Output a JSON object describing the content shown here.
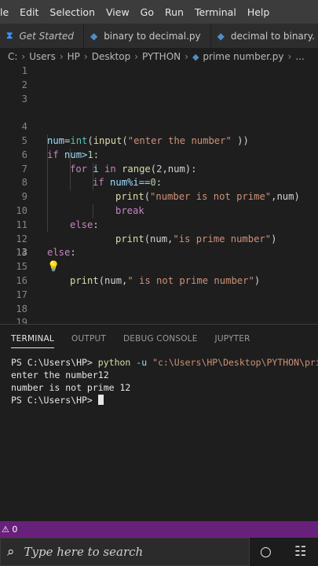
{
  "menubar": {
    "items": [
      "le",
      "Edit",
      "Selection",
      "View",
      "Go",
      "Run",
      "Terminal",
      "Help"
    ]
  },
  "tabs": [
    {
      "label": "Get Started",
      "icon": "vscode-icon",
      "active": true
    },
    {
      "label": "binary to decimal.py",
      "icon": "python-file-icon",
      "active": false
    },
    {
      "label": "decimal to binary.",
      "icon": "python-file-icon",
      "active": false
    }
  ],
  "breadcrumb": {
    "items": [
      "C:",
      "Users",
      "HP",
      "Desktop",
      "PYTHON",
      "prime number.py",
      "..."
    ]
  },
  "editor": {
    "line_numbers": [
      "1",
      "2",
      "3",
      "4",
      "5",
      "6",
      "7",
      "8",
      "9",
      "10",
      "11",
      "12",
      "13",
      "14",
      "15",
      "16",
      "17",
      "18",
      "19"
    ],
    "current_line": "13",
    "code": {
      "l4_a": "num",
      "l4_b": "=",
      "l4_c": "int",
      "l4_d": "(",
      "l4_e": "input",
      "l4_f": "(",
      "l4_g": "\"enter the number\"",
      "l4_h": " ))",
      "l5_a": "if",
      "l5_b": " num>",
      "l5_c": "1",
      "l5_d": ":",
      "l6_a": "for",
      "l6_b": " i ",
      "l6_c": "in",
      "l6_d": " ",
      "l6_e": "range",
      "l6_f": "(",
      "l6_g": "2",
      "l6_h": ",num):",
      "l7_a": "if",
      "l7_b": " num%i==",
      "l7_c": "0",
      "l7_d": ":",
      "l8_a": "print",
      "l8_b": "(",
      "l8_c": "\"number is not prime\"",
      "l8_d": ",num)",
      "l9_a": "break",
      "l10_a": "else",
      "l10_b": ":",
      "l11_a": "print",
      "l11_b": "(num,",
      "l11_c": "\"is prime number\"",
      "l11_d": ")",
      "l12_a": "else",
      "l12_b": ":",
      "l13_a": "print",
      "l13_b": "(num,",
      "l13_c": "\" is not prime number\"",
      "l13_d": ")"
    }
  },
  "panel": {
    "tabs": [
      {
        "label": "TERMINAL",
        "active": true
      },
      {
        "label": "OUTPUT",
        "active": false
      },
      {
        "label": "DEBUG CONSOLE",
        "active": false
      },
      {
        "label": "JUPYTER",
        "active": false
      }
    ]
  },
  "terminal": {
    "prompt": "PS C:\\Users\\HP>",
    "cmd": "python",
    "flag": "-u",
    "path": "\"c:\\Users\\HP\\Desktop\\PYTHON\\prime",
    "out1": "enter the number12",
    "out2": "number is not prime 12",
    "prompt2": "PS C:\\Users\\HP>"
  },
  "statusbar": {
    "text": "⚠ 0"
  },
  "taskbar": {
    "search_placeholder": "Type here to search"
  }
}
